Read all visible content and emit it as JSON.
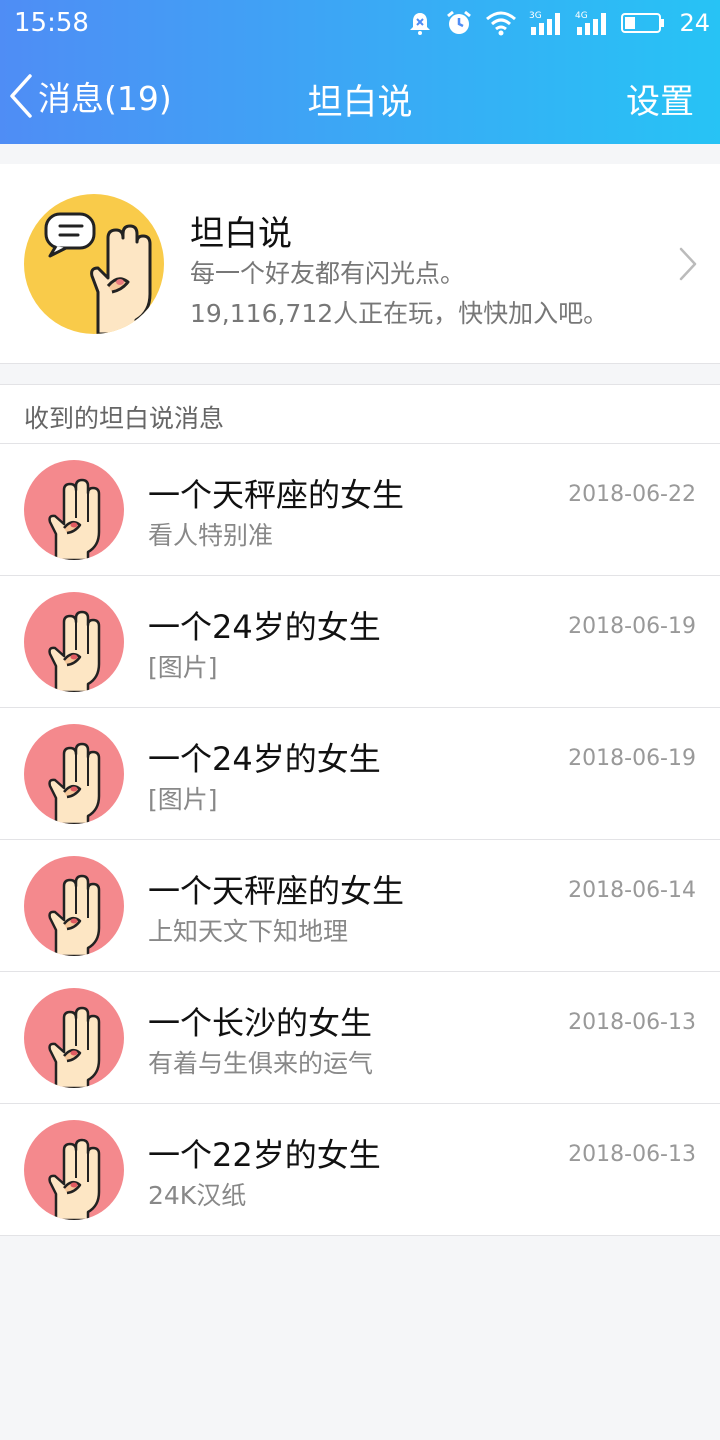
{
  "status_bar": {
    "time": "15:58",
    "battery": "24",
    "net1": "3G",
    "net2": "4G"
  },
  "navbar": {
    "back_label": "消息(19)",
    "title": "坦白说",
    "settings_label": "设置"
  },
  "intro": {
    "title": "坦白说",
    "line1": "每一个好友都有闪光点。",
    "line2": "19,116,712人正在玩，快快加入吧。"
  },
  "section": {
    "title": "收到的坦白说消息"
  },
  "messages": [
    {
      "title": "一个天秤座的女生",
      "subtitle": "看人特别准",
      "date": "2018-06-22"
    },
    {
      "title": "一个24岁的女生",
      "subtitle": "[图片]",
      "date": "2018-06-19"
    },
    {
      "title": "一个24岁的女生",
      "subtitle": "[图片]",
      "date": "2018-06-19"
    },
    {
      "title": "一个天秤座的女生",
      "subtitle": "上知天文下知地理",
      "date": "2018-06-14"
    },
    {
      "title": "一个长沙的女生",
      "subtitle": "有着与生俱来的运气",
      "date": "2018-06-13"
    },
    {
      "title": "一个22岁的女生",
      "subtitle": "24K汉纸",
      "date": "2018-06-13"
    }
  ],
  "colors": {
    "header_start": "#4f8df5",
    "header_end": "#27c3f5",
    "intro_avatar_bg": "#f9cb4a",
    "msg_avatar_bg": "#f4898d"
  },
  "icons": {
    "back": "chevron-left-icon",
    "chevron": "chevron-right-icon",
    "avatar": "hand-gesture-icon"
  }
}
